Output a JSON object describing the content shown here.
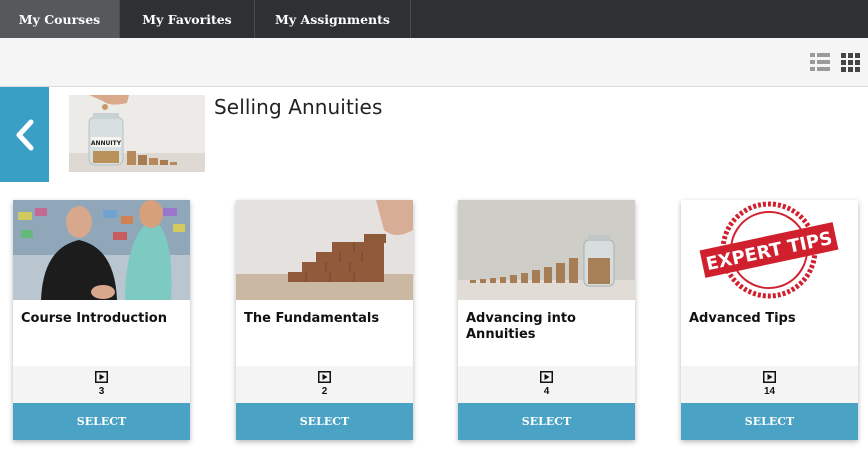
{
  "tabs": [
    {
      "label": "My Courses",
      "active": true
    },
    {
      "label": "My Favorites",
      "active": false
    },
    {
      "label": "My Assignments",
      "active": false
    }
  ],
  "toolbar": {
    "list_view_icon": "list-view-icon",
    "grid_view_icon": "grid-view-icon"
  },
  "course": {
    "title": "Selling Annuities",
    "thumbnail_icon": "annuity-jar-image",
    "jar_label": "ANNUITY"
  },
  "modules": [
    {
      "title": "Course Introduction",
      "count": "3",
      "button": "SELECT",
      "image": "presenter-photo"
    },
    {
      "title": "The Fundamentals",
      "count": "2",
      "button": "SELECT",
      "image": "wooden-blocks-stairs-photo"
    },
    {
      "title": "Advancing into Annuities",
      "count": "4",
      "button": "SELECT",
      "image": "coin-stacks-jar-photo"
    },
    {
      "title": "Advanced Tips",
      "count": "14",
      "button": "SELECT",
      "image": "expert-tips-stamp",
      "stamp_text": "EXPERT TIPS"
    }
  ],
  "colors": {
    "accent": "#4aa3c4",
    "tabbar": "#2e3134",
    "stamp": "#d0202e"
  }
}
